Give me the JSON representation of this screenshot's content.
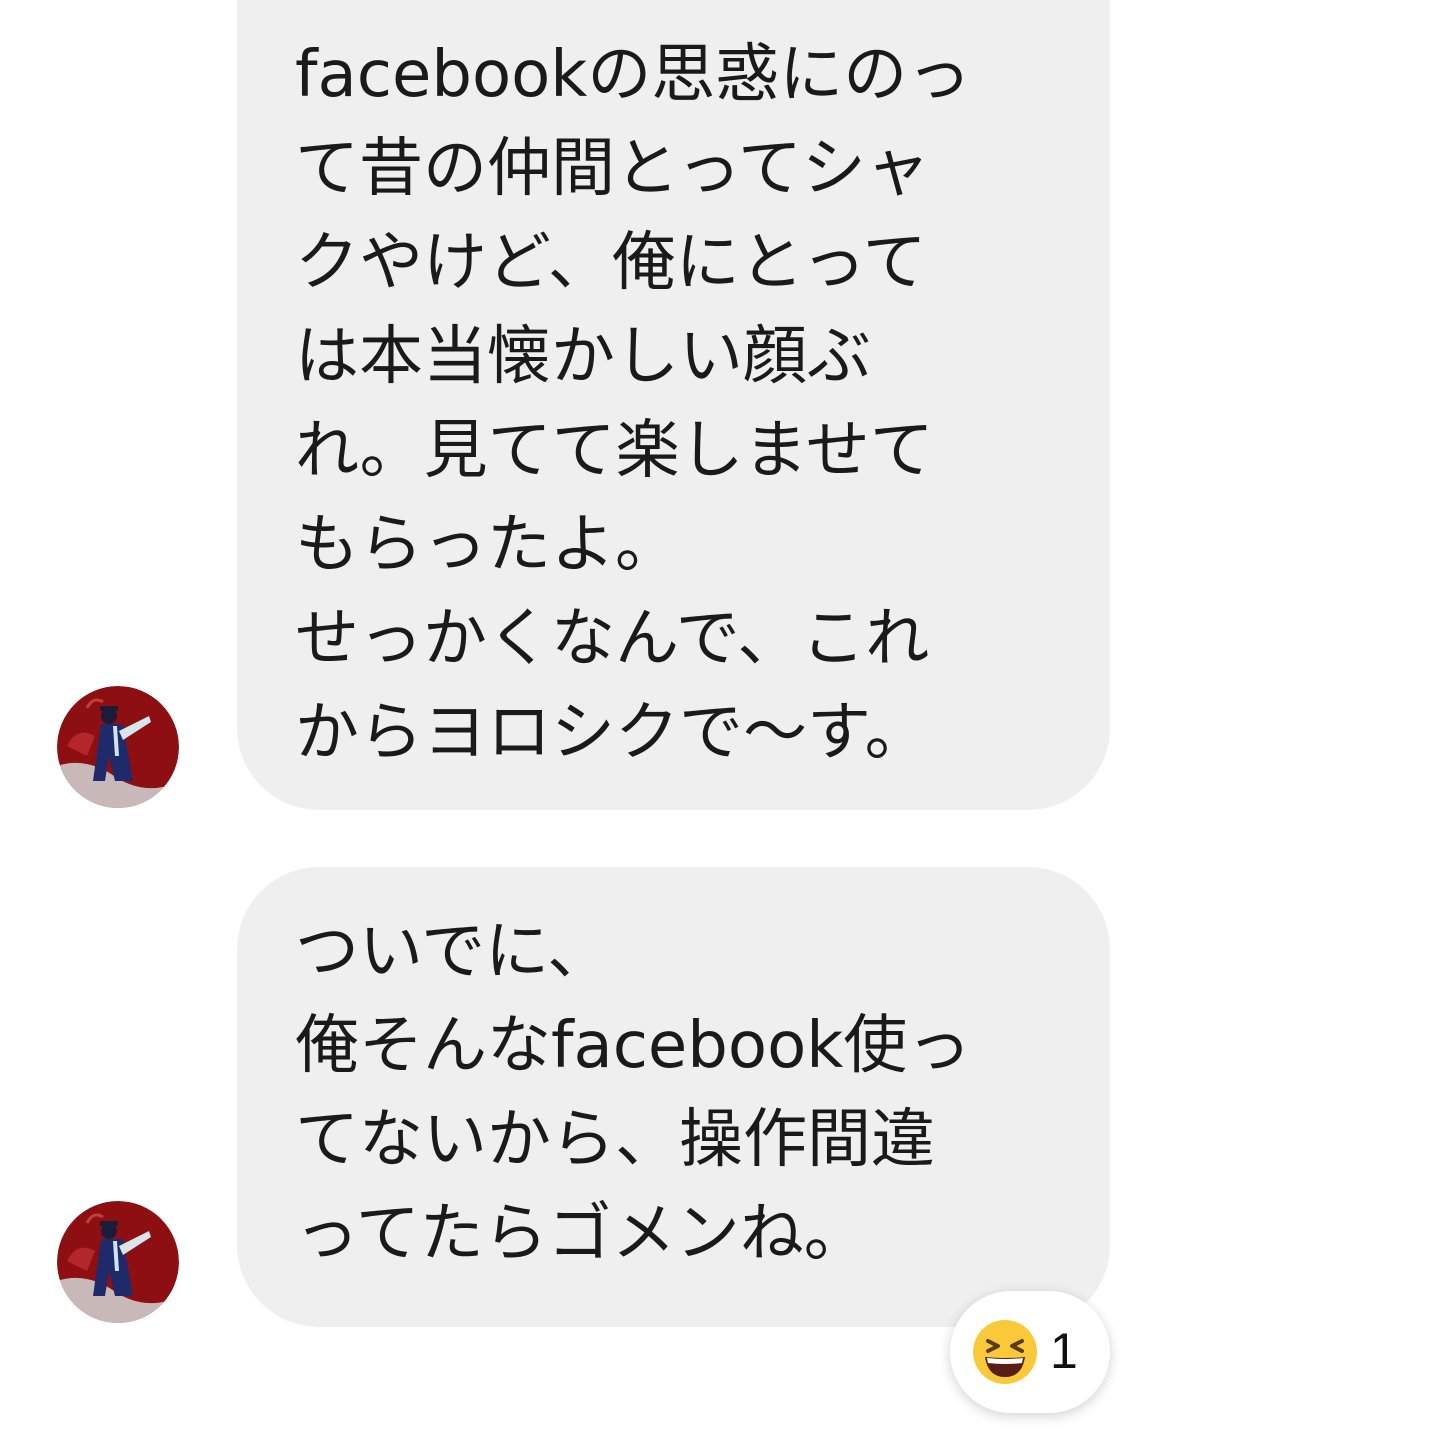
{
  "messages": [
    {
      "lines": [
        "facebookの思惑にのっ",
        "て昔の仲間とってシャ",
        "クやけど、俺にとって",
        "は本当懐かしい顔ぶ",
        "れ。見てて楽しませて",
        "もらったよ。",
        "せっかくなんで、これ",
        "からヨロシクで〜す。"
      ]
    },
    {
      "lines": [
        "ついでに、",
        "俺そんなfacebook使っ",
        "てないから、操作間違",
        "ってたらゴメンね。"
      ],
      "reaction": {
        "emoji": "grinning-squinting-face-icon",
        "count": "1"
      }
    }
  ],
  "colors": {
    "bubble": "#efefef",
    "text": "#1a1a1a",
    "avatar_background": "#8e0f12",
    "reaction_emoji": "#f9c93a"
  }
}
